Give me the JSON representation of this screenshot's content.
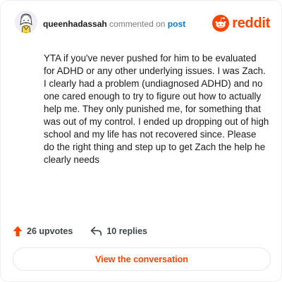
{
  "header": {
    "username": "queenhadassah",
    "commented_text": "commented on",
    "post_link": "post"
  },
  "brand": {
    "name": "reddit",
    "accent_color": "#ff4500"
  },
  "comment": {
    "text": "YTA if you've never pushed for him to be evaluated for ADHD or any other underlying issues. I was Zach. I clearly had a problem (undiagnosed ADHD) and no one cared enough to try to figure out how to actually help me. They only punished me, for something that was out of my control. I ended up dropping out of high school and my life has not recovered since. Please do the right thing and step up to get Zach the help he clearly needs"
  },
  "stats": {
    "upvotes": "26 upvotes",
    "replies": "10 replies"
  },
  "cta": {
    "label": "View the conversation"
  },
  "icons": {
    "avatar": "avatar-icon",
    "upvote": "upvote-arrow-icon",
    "reply": "reply-arrow-icon",
    "logo": "reddit-snoo-icon"
  }
}
